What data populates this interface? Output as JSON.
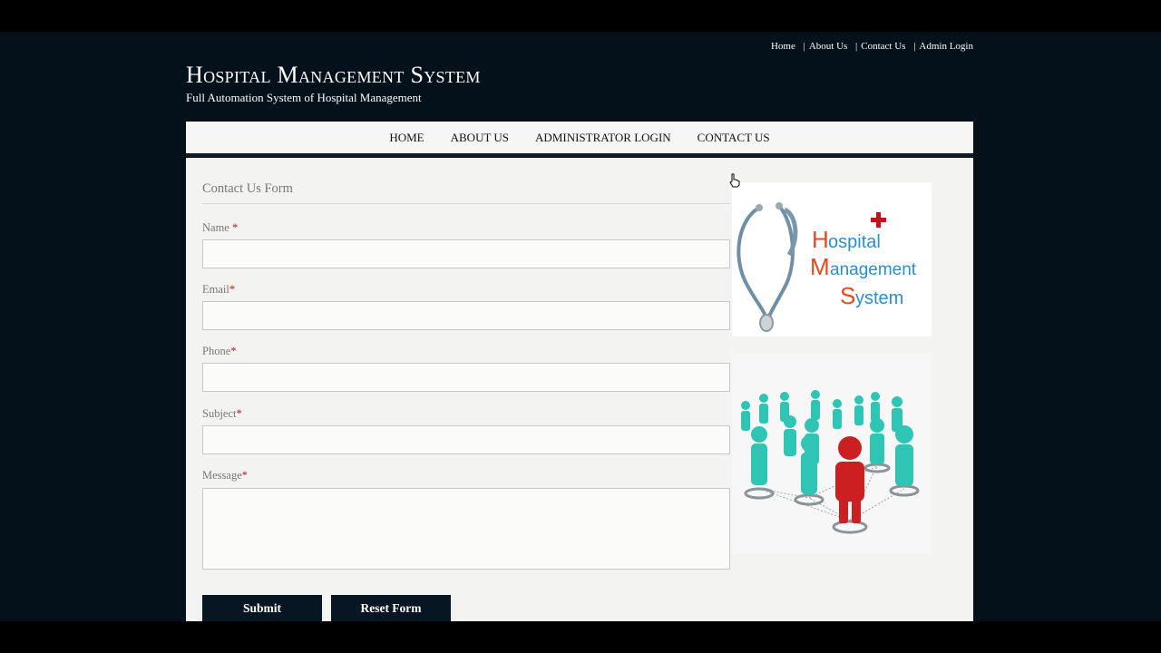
{
  "top_links": [
    {
      "label": "Home"
    },
    {
      "label": "About Us"
    },
    {
      "label": "Contact Us"
    },
    {
      "label": "Admin Login"
    }
  ],
  "header": {
    "title": "Hospital Management System",
    "subtitle": "Full Automation System of Hospital Management"
  },
  "nav": {
    "items": [
      {
        "label": "HOME"
      },
      {
        "label": "ABOUT US"
      },
      {
        "label": "ADMINISTRATOR LOGIN"
      },
      {
        "label": "CONTACT US"
      }
    ]
  },
  "form": {
    "heading": "Contact Us Form",
    "required_marker": "*",
    "fields": {
      "name": {
        "label": "Name",
        "value": ""
      },
      "email": {
        "label": "Email",
        "value": ""
      },
      "phone": {
        "label": "Phone",
        "value": ""
      },
      "subject": {
        "label": "Subject",
        "value": ""
      },
      "message": {
        "label": "Message",
        "value": ""
      }
    },
    "submit_label": "Submit",
    "reset_label": "Reset Form"
  },
  "logo_image": {
    "lines": [
      "Hospital",
      "Management",
      "System"
    ],
    "letter_color": "#e8491d",
    "text_color": "#2a8fd0",
    "cross_color": "#c0141c"
  },
  "people_image": {
    "leader_color": "#cc1f22",
    "team_color": "#2ec5b5"
  },
  "icons": {
    "stethoscope": "stethoscope-icon",
    "cursor": "hand-cursor-icon"
  }
}
